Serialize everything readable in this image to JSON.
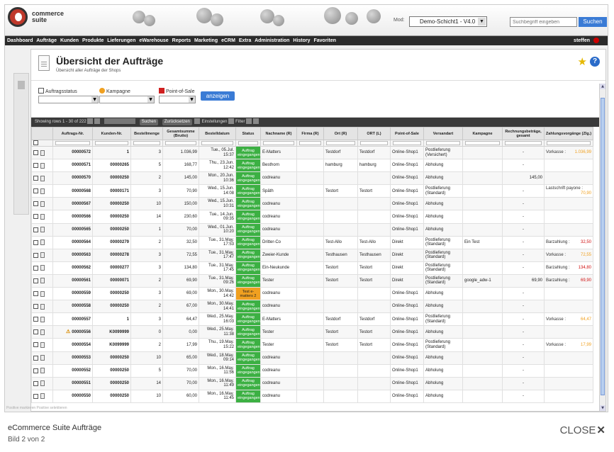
{
  "app": {
    "logo_line1": "commerce",
    "logo_line2": "suite",
    "mode_label": "Mod:",
    "mode_value": "Demo-Schicht1 - V4.0",
    "search_placeholder": "Suchbegriff eingeben",
    "search_button": "Suchen",
    "user": "steffen"
  },
  "nav": [
    "Dashboard",
    "Aufträge",
    "Kunden",
    "Produkte",
    "Lieferungen",
    "eWarehouse",
    "Reports",
    "Marketing",
    "eCRM",
    "Extra",
    "Administration",
    "History",
    "Favoriten"
  ],
  "header": {
    "title": "Übersicht der Aufträge",
    "subtitle": "Übersicht aller Aufträge der Shops",
    "star_icon": "★",
    "help_icon": "?"
  },
  "filters": {
    "status_label": "Auftragsstatus",
    "campaign_label": "Kampagne",
    "pos_label": "Point-of-Sale",
    "show_button": "anzeigen"
  },
  "gridbar": {
    "showing": "Showing rows 1 - 30 of 222",
    "search": "Suchen",
    "reset": "Zurücksetzen",
    "settings": "Einstellungen",
    "filter": "Filter"
  },
  "columns": [
    "",
    "Auftrags-Nr.",
    "Kunden-Nr.",
    "Bestellmenge",
    "Gesamtsumme (Brutto)",
    "Bestelldatum",
    "Status",
    "Nachname (R)",
    "Firma (R)",
    "Ort (R)",
    "ORT (L)",
    "Point-of-Sale",
    "Versandart",
    "Kampagne",
    "Rechnungsbeträge, gesamt",
    "Zahlungsvorgänge (Zlg.)"
  ],
  "rows": [
    {
      "nr": "00000572",
      "kunde": "1",
      "menge": "3",
      "summe": "1.036,99",
      "datum": "Tue., 05.Jul.",
      "zeit": "15:37",
      "status": "Auftrag eingegangen",
      "name": "E-Matters",
      "firma": "",
      "ort_r": "Testdorf",
      "ort_l": "Testdorf",
      "pos": "Online-Shop1",
      "versand": "Postlieferung (Versichert)",
      "kampagne": "",
      "rechnung": "-",
      "zahl_typ": "Vorkasse",
      "zahl_sep": ":",
      "zahl_betrag": "1.036,99",
      "zahl_col": "or",
      "warn": false
    },
    {
      "nr": "00000571",
      "kunde": "00000265",
      "menge": "5",
      "summe": "168,77",
      "datum": "Thu., 23.Jun.",
      "zeit": "12:42",
      "status": "Auftrag eingegangen",
      "name": "Besthorn",
      "firma": "",
      "ort_r": "hamburg",
      "ort_l": "hamburg",
      "pos": "Online-Shop1",
      "versand": "Abholung",
      "kampagne": "",
      "rechnung": "-",
      "zahl_typ": "",
      "zahl_sep": "",
      "zahl_betrag": "",
      "zahl_col": "",
      "warn": false
    },
    {
      "nr": "00000570",
      "kunde": "00000250",
      "menge": "2",
      "summe": "145,00",
      "datum": "Mon., 20.Jun.",
      "zeit": "10:36",
      "status": "Auftrag eingegangen",
      "name": "codreanu",
      "firma": "",
      "ort_r": "",
      "ort_l": "",
      "pos": "Online-Shop1",
      "versand": "Abholung",
      "kampagne": "",
      "rechnung": "145,00",
      "zahl_typ": "",
      "zahl_sep": "",
      "zahl_betrag": "",
      "zahl_col": "",
      "warn": false
    },
    {
      "nr": "00000568",
      "kunde": "00000171",
      "menge": "3",
      "summe": "70,90",
      "datum": "Wed., 15.Jun.",
      "zeit": "14:08",
      "status": "Auftrag eingegangen",
      "name": "Späth",
      "firma": "",
      "ort_r": "Testort",
      "ort_l": "Testort",
      "pos": "Online-Shop1",
      "versand": "Postlieferung (Standard)",
      "kampagne": "",
      "rechnung": "-",
      "zahl_typ": "Lastschrift payone",
      "zahl_sep": ":",
      "zahl_betrag": "70,90",
      "zahl_col": "or",
      "warn": false
    },
    {
      "nr": "00000567",
      "kunde": "00000250",
      "menge": "10",
      "summe": "150,00",
      "datum": "Wed., 15.Jun.",
      "zeit": "10:31",
      "status": "Auftrag eingegangen",
      "name": "codreanu",
      "firma": "",
      "ort_r": "",
      "ort_l": "",
      "pos": "Online-Shop1",
      "versand": "Abholung",
      "kampagne": "",
      "rechnung": "-",
      "zahl_typ": "",
      "zahl_sep": "",
      "zahl_betrag": "",
      "zahl_col": "",
      "warn": false
    },
    {
      "nr": "00000566",
      "kunde": "00000250",
      "menge": "14",
      "summe": "230,60",
      "datum": "Tue., 14.Jun.",
      "zeit": "09:35",
      "status": "Auftrag eingegangen",
      "name": "codreanu",
      "firma": "",
      "ort_r": "",
      "ort_l": "",
      "pos": "Online-Shop1",
      "versand": "Abholung",
      "kampagne": "",
      "rechnung": "-",
      "zahl_typ": "",
      "zahl_sep": "",
      "zahl_betrag": "",
      "zahl_col": "",
      "warn": false
    },
    {
      "nr": "00000565",
      "kunde": "00000250",
      "menge": "1",
      "summe": "70,00",
      "datum": "Wed., 01.Jun.",
      "zeit": "10:20",
      "status": "Auftrag eingegangen",
      "name": "codreanu",
      "firma": "",
      "ort_r": "",
      "ort_l": "",
      "pos": "Online-Shop1",
      "versand": "Abholung",
      "kampagne": "",
      "rechnung": "-",
      "zahl_typ": "",
      "zahl_sep": "",
      "zahl_betrag": "",
      "zahl_col": "",
      "warn": false
    },
    {
      "nr": "00000564",
      "kunde": "00000279",
      "menge": "2",
      "summe": "32,50",
      "datum": "Tue., 31.May.",
      "zeit": "17:53",
      "status": "Auftrag eingegangen",
      "name": "Dritter-Co",
      "firma": "",
      "ort_r": "Test-Allo",
      "ort_l": "Test-Allo",
      "pos": "Direkt",
      "versand": "Postlieferung (Standard)",
      "kampagne": "Ein Test",
      "rechnung": "-",
      "zahl_typ": "Barzahlung",
      "zahl_sep": ":",
      "zahl_betrag": "32,50",
      "zahl_col": "red",
      "warn": false
    },
    {
      "nr": "00000563",
      "kunde": "00000278",
      "menge": "3",
      "summe": "72,55",
      "datum": "Tue., 31.May.",
      "zeit": "17:47",
      "status": "Auftrag eingegangen",
      "name": "Zweier-Kunde",
      "firma": "",
      "ort_r": "Testhausen",
      "ort_l": "Testhausen",
      "pos": "Direkt",
      "versand": "Postlieferung (Standard)",
      "kampagne": "",
      "rechnung": "-",
      "zahl_typ": "Vorkasse",
      "zahl_sep": ":",
      "zahl_betrag": "72,55",
      "zahl_col": "or",
      "warn": false
    },
    {
      "nr": "00000562",
      "kunde": "00000277",
      "menge": "3",
      "summe": "134,80",
      "datum": "Tue., 31.May.",
      "zeit": "17:45",
      "status": "Auftrag eingegangen",
      "name": "Ein-Neukunde",
      "firma": "",
      "ort_r": "Testort",
      "ort_l": "Testort",
      "pos": "Direkt",
      "versand": "Postlieferung (Standard)",
      "kampagne": "",
      "rechnung": "-",
      "zahl_typ": "Barzahlung",
      "zahl_sep": ":",
      "zahl_betrag": "134,80",
      "zahl_col": "red",
      "warn": false
    },
    {
      "nr": "00000561",
      "kunde": "00000071",
      "menge": "2",
      "summe": "69,90",
      "datum": "Tue., 31.May.",
      "zeit": "09:26",
      "status": "Auftrag eingegangen",
      "name": "Tester",
      "firma": "",
      "ort_r": "Testort",
      "ort_l": "Testort",
      "pos": "Direkt",
      "versand": "Postlieferung (Standard)",
      "kampagne": "google_adw-1",
      "rechnung": "69,90",
      "zahl_typ": "Barzahlung",
      "zahl_sep": ":",
      "zahl_betrag": "69,90",
      "zahl_col": "red",
      "warn": false
    },
    {
      "nr": "00000559",
      "kunde": "00000250",
      "menge": "3",
      "summe": "69,00",
      "datum": "Mon., 30.May.",
      "zeit": "14:42",
      "status": "Test e-matters 2",
      "status_color": "orange",
      "name": "codreanu",
      "firma": "",
      "ort_r": "",
      "ort_l": "",
      "pos": "Online-Shop1",
      "versand": "Abholung",
      "kampagne": "",
      "rechnung": "-",
      "zahl_typ": "",
      "zahl_sep": "",
      "zahl_betrag": "",
      "zahl_col": "",
      "warn": false
    },
    {
      "nr": "00000558",
      "kunde": "00000250",
      "menge": "2",
      "summe": "67,00",
      "datum": "Mon., 30.May.",
      "zeit": "14:41",
      "status": "Auftrag eingegangen",
      "name": "codreanu",
      "firma": "",
      "ort_r": "",
      "ort_l": "",
      "pos": "Online-Shop1",
      "versand": "Abholung",
      "kampagne": "",
      "rechnung": "-",
      "zahl_typ": "",
      "zahl_sep": "",
      "zahl_betrag": "",
      "zahl_col": "",
      "warn": false
    },
    {
      "nr": "00000557",
      "kunde": "1",
      "menge": "3",
      "summe": "64,47",
      "datum": "Wed., 25.May.",
      "zeit": "16:03",
      "status": "Auftrag eingegangen",
      "name": "E-Matters",
      "firma": "",
      "ort_r": "Testdorf",
      "ort_l": "Testdorf",
      "pos": "Online-Shop1",
      "versand": "Postlieferung (Standard)",
      "kampagne": "",
      "rechnung": "-",
      "zahl_typ": "Vorkasse",
      "zahl_sep": ":",
      "zahl_betrag": "64,47",
      "zahl_col": "or",
      "warn": false
    },
    {
      "nr": "00000556",
      "kunde": "K0099999",
      "menge": "0",
      "summe": "0,00",
      "datum": "Wed., 25.May.",
      "zeit": "11:38",
      "status": "Auftrag eingegangen",
      "name": "Tester",
      "firma": "",
      "ort_r": "Testort",
      "ort_l": "Testort",
      "pos": "Online-Shop1",
      "versand": "Abholung",
      "kampagne": "",
      "rechnung": "-",
      "zahl_typ": "",
      "zahl_sep": "",
      "zahl_betrag": "",
      "zahl_col": "",
      "warn": true
    },
    {
      "nr": "00000554",
      "kunde": "K0099999",
      "menge": "2",
      "summe": "17,99",
      "datum": "Thu., 19.May.",
      "zeit": "15:22",
      "status": "Auftrag eingegangen",
      "name": "Tester",
      "firma": "",
      "ort_r": "Testort",
      "ort_l": "Testort",
      "pos": "Online-Shop1",
      "versand": "Postlieferung (Standard)",
      "kampagne": "",
      "rechnung": "-",
      "zahl_typ": "Vorkasse",
      "zahl_sep": ":",
      "zahl_betrag": "17,99",
      "zahl_col": "or",
      "warn": false
    },
    {
      "nr": "00000553",
      "kunde": "00000250",
      "menge": "10",
      "summe": "65,00",
      "datum": "Wed., 18.May.",
      "zeit": "09:14",
      "status": "Auftrag eingegangen",
      "name": "codreanu",
      "firma": "",
      "ort_r": "",
      "ort_l": "",
      "pos": "Online-Shop1",
      "versand": "Abholung",
      "kampagne": "",
      "rechnung": "-",
      "zahl_typ": "",
      "zahl_sep": "",
      "zahl_betrag": "",
      "zahl_col": "",
      "warn": false
    },
    {
      "nr": "00000552",
      "kunde": "00000250",
      "menge": "5",
      "summe": "70,00",
      "datum": "Mon., 16.May.",
      "zeit": "11:56",
      "status": "Auftrag eingegangen",
      "name": "codreanu",
      "firma": "",
      "ort_r": "",
      "ort_l": "",
      "pos": "Online-Shop1",
      "versand": "Abholung",
      "kampagne": "",
      "rechnung": "-",
      "zahl_typ": "",
      "zahl_sep": "",
      "zahl_betrag": "",
      "zahl_col": "",
      "warn": false
    },
    {
      "nr": "00000551",
      "kunde": "00000250",
      "menge": "14",
      "summe": "70,00",
      "datum": "Mon., 16.May.",
      "zeit": "11:49",
      "status": "Auftrag eingegangen",
      "name": "codreanu",
      "firma": "",
      "ort_r": "",
      "ort_l": "",
      "pos": "Online-Shop1",
      "versand": "Abholung",
      "kampagne": "",
      "rechnung": "-",
      "zahl_typ": "",
      "zahl_sep": "",
      "zahl_betrag": "",
      "zahl_col": "",
      "warn": false
    },
    {
      "nr": "00000550",
      "kunde": "00000250",
      "menge": "10",
      "summe": "60,00",
      "datum": "Mon., 16.May.",
      "zeit": "11:45",
      "status": "Auftrag eingegangen",
      "name": "codreanu",
      "firma": "",
      "ort_r": "",
      "ort_l": "",
      "pos": "Online-Shop1",
      "versand": "Abholung",
      "kampagne": "",
      "rechnung": "-",
      "zahl_typ": "",
      "zahl_sep": "",
      "zahl_betrag": "",
      "zahl_col": "",
      "warn": false
    }
  ],
  "footer_links": "Positive markieren    Positive selektieren",
  "caption": {
    "title": "eCommerce Suite Aufträge",
    "sub": "Bild 2 von 2",
    "close": "CLOSE",
    "close_icon": "✕"
  }
}
